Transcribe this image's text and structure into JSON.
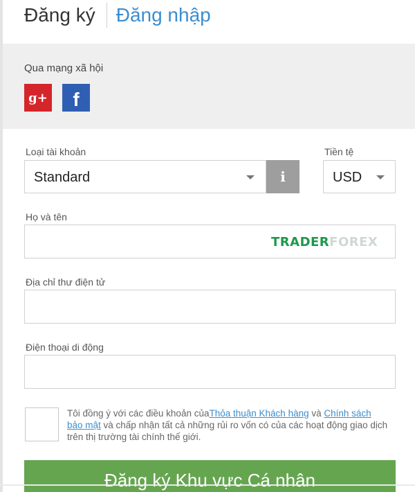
{
  "tabs": {
    "register": "Đăng ký",
    "login": "Đăng nhập"
  },
  "social": {
    "label": "Qua mạng xã hội",
    "google_plus": "g+",
    "facebook": "f"
  },
  "account_type": {
    "label": "Loại tài khoản",
    "value": "Standard",
    "info_icon": "i"
  },
  "currency": {
    "label": "Tiền tệ",
    "value": "USD"
  },
  "full_name": {
    "label": "Họ và tên",
    "value": ""
  },
  "email": {
    "label": "Địa chỉ thư điện tử",
    "value": ""
  },
  "phone": {
    "label": "Điện thoại di động",
    "value": ""
  },
  "watermark": {
    "part1": "TRADER",
    "part2": "FOREX"
  },
  "terms": {
    "text_before": "Tôi đồng ý với các điều khoản của",
    "link_agreement": "Thỏa thuận Khách hàng",
    "text_and": " và ",
    "link_privacy": "Chính sách bảo mật",
    "text_after": " và chấp nhận tất cả những rủi ro vốn có của các hoạt động giao dịch trên thị trường tài chính thế giới."
  },
  "submit": {
    "label": "Đăng ký Khu vực Cá nhân"
  },
  "colors": {
    "accent_blue": "#3b8dd0",
    "submit_green": "#65a550",
    "google_red": "#d4262a",
    "facebook_blue": "#2f5fb3"
  }
}
